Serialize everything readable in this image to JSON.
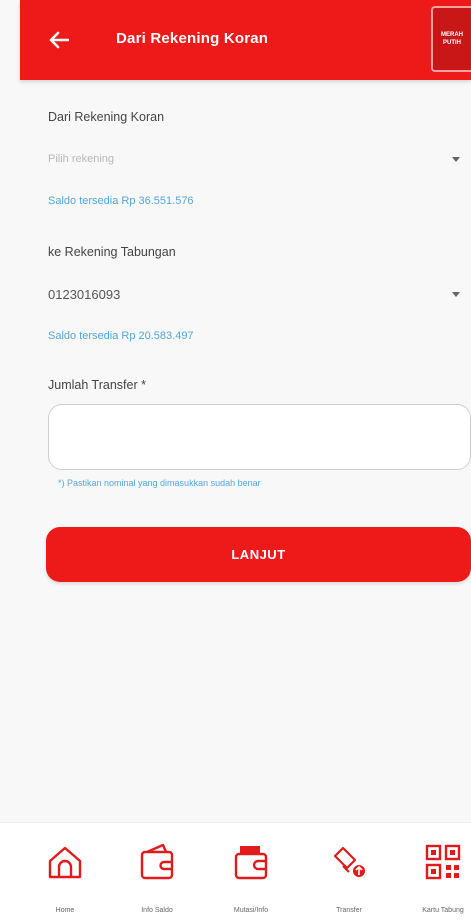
{
  "header": {
    "title": "Dari Rekening Koran",
    "badge_line1": "MERAH",
    "badge_line2": "PUTIH"
  },
  "form": {
    "from_label": "Dari Rekening Koran",
    "from_placeholder": "Pilih rekening",
    "from_balance": "Saldo tersedia Rp 36.551.576",
    "to_label": "ke Rekening Tabungan",
    "to_value": "0123016093",
    "to_balance": "Saldo tersedia Rp 20.583.497",
    "amount_label": "Jumlah Transfer *",
    "amount_value": "",
    "amount_hint": "*) Pastikan nominal yang dimasukkan sudah benar",
    "submit_label": "LANJUT"
  },
  "bottom_nav": [
    {
      "label": "Home",
      "icon": "home-icon"
    },
    {
      "label": "Info Saldo",
      "icon": "wallet-icon"
    },
    {
      "label": "Mutasi/Info",
      "icon": "wallet-card-icon"
    },
    {
      "label": "Transfer",
      "icon": "transfer-icon"
    },
    {
      "label": "Kartu Tabung",
      "icon": "qr-icon"
    }
  ],
  "colors": {
    "primary": "#ee1a1a",
    "link": "#53a7e0"
  }
}
